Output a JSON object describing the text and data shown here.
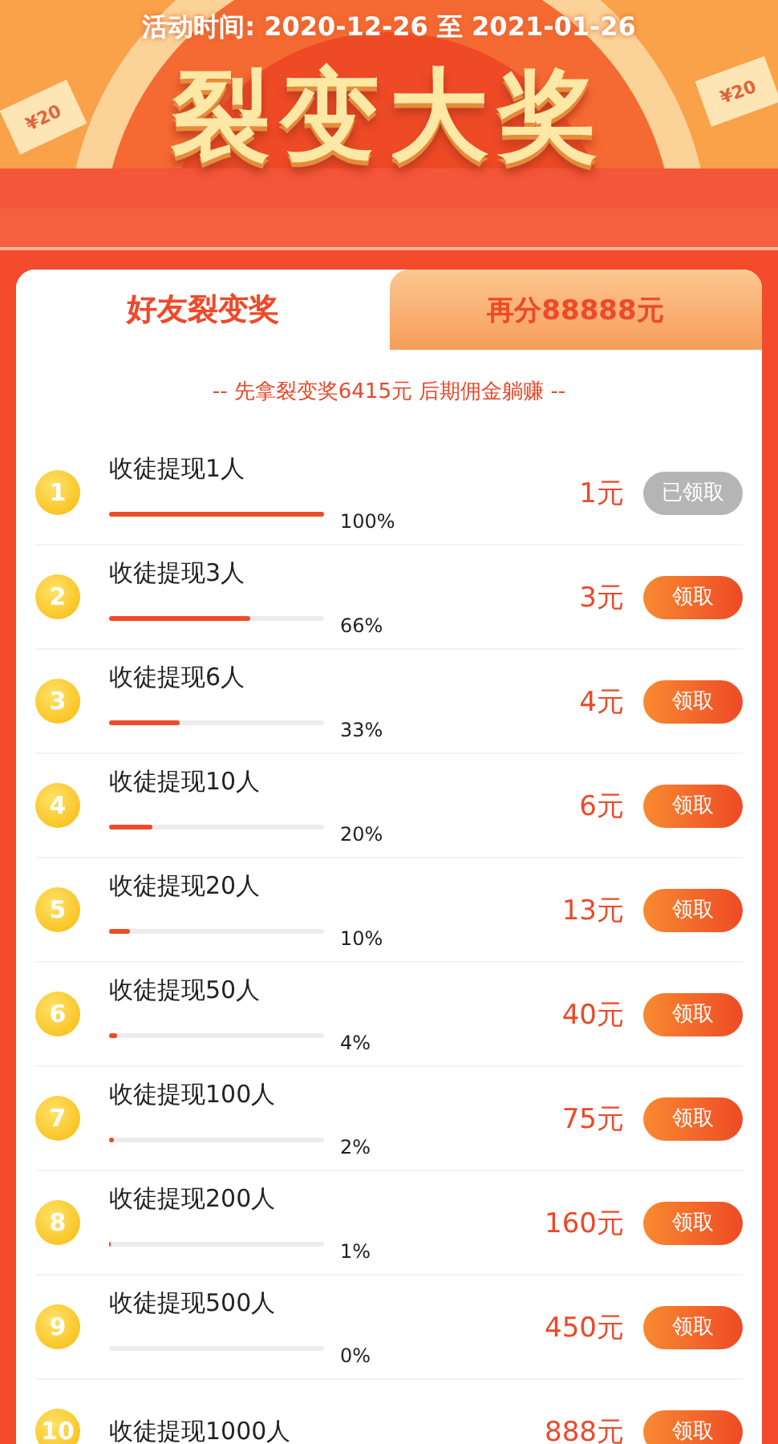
{
  "header": {
    "period": "活动时间: 2020-12-26 至 2021-01-26",
    "title": "裂变大奖",
    "bills": [
      "¥20",
      "¥20"
    ]
  },
  "tabs": [
    {
      "label": "好友裂变奖",
      "selected": true
    },
    {
      "label": "再分88888元",
      "selected": false
    }
  ],
  "subtitle": "-- 先拿裂变奖6415元 后期佣金躺赚 --",
  "tasks": [
    {
      "rank": "1",
      "name": "收徒提现1人",
      "level": 1,
      "percent": "100%",
      "reward": "1元",
      "button": "已领取",
      "claimed": true
    },
    {
      "rank": "2",
      "name": "收徒提现3人",
      "level": 0.66,
      "percent": "66%",
      "reward": "3元",
      "button": "领取",
      "claimed": false
    },
    {
      "rank": "3",
      "name": "收徒提现6人",
      "level": 0.33,
      "percent": "33%",
      "reward": "4元",
      "button": "领取",
      "claimed": false
    },
    {
      "rank": "4",
      "name": "收徒提现10人",
      "level": 0.2,
      "percent": "20%",
      "reward": "6元",
      "button": "领取",
      "claimed": false
    },
    {
      "rank": "5",
      "name": "收徒提现20人",
      "level": 0.1,
      "percent": "10%",
      "reward": "13元",
      "button": "领取",
      "claimed": false
    },
    {
      "rank": "6",
      "name": "收徒提现50人",
      "level": 0.04,
      "percent": "4%",
      "reward": "40元",
      "button": "领取",
      "claimed": false
    },
    {
      "rank": "7",
      "name": "收徒提现100人",
      "level": 0.02,
      "percent": "2%",
      "reward": "75元",
      "button": "领取",
      "claimed": false
    },
    {
      "rank": "8",
      "name": "收徒提现200人",
      "level": 0.01,
      "percent": "1%",
      "reward": "160元",
      "button": "领取",
      "claimed": false
    },
    {
      "rank": "9",
      "name": "收徒提现500人",
      "level": 0,
      "percent": "0%",
      "reward": "450元",
      "button": "领取",
      "claimed": false
    },
    {
      "rank": "10",
      "name": "收徒提现1000人",
      "reward": "888元",
      "button": "领取",
      "claimed": false
    }
  ]
}
